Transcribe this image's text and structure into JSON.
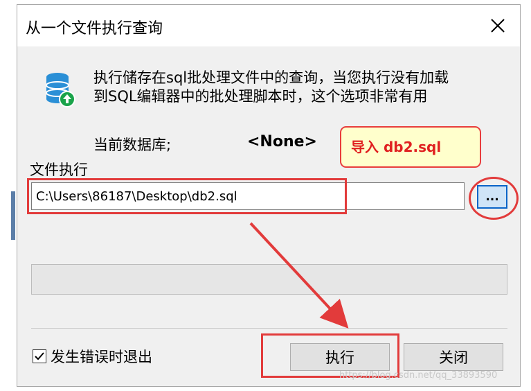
{
  "window": {
    "title": "从一个文件执行查询",
    "close_symbol": "✕"
  },
  "description": {
    "line1": "执行储存在sql批处理文件中的查询，当您执行没有加载",
    "line2": "到SQL编辑器中的批处理脚本时，这个选项非常有用"
  },
  "database": {
    "label": "当前数据库;",
    "value": "<None>"
  },
  "annotation": {
    "text": "导入 db2.sql"
  },
  "file": {
    "section_label": "文件执行",
    "path_value": "C:\\Users\\86187\\Desktop\\db2.sql",
    "browse_label": "..."
  },
  "progress": {
    "percent": 0
  },
  "options": {
    "exit_on_error_label": "发生错误时退出",
    "exit_on_error_checked": true
  },
  "buttons": {
    "execute_label": "执行",
    "close_label": "关闭"
  },
  "watermark": "https://blog.csdn.net/qq_33893590",
  "colors": {
    "highlight_red": "#e23b3b",
    "callout_bg": "#ffffcc",
    "accent_blue": "#0a64c8"
  }
}
